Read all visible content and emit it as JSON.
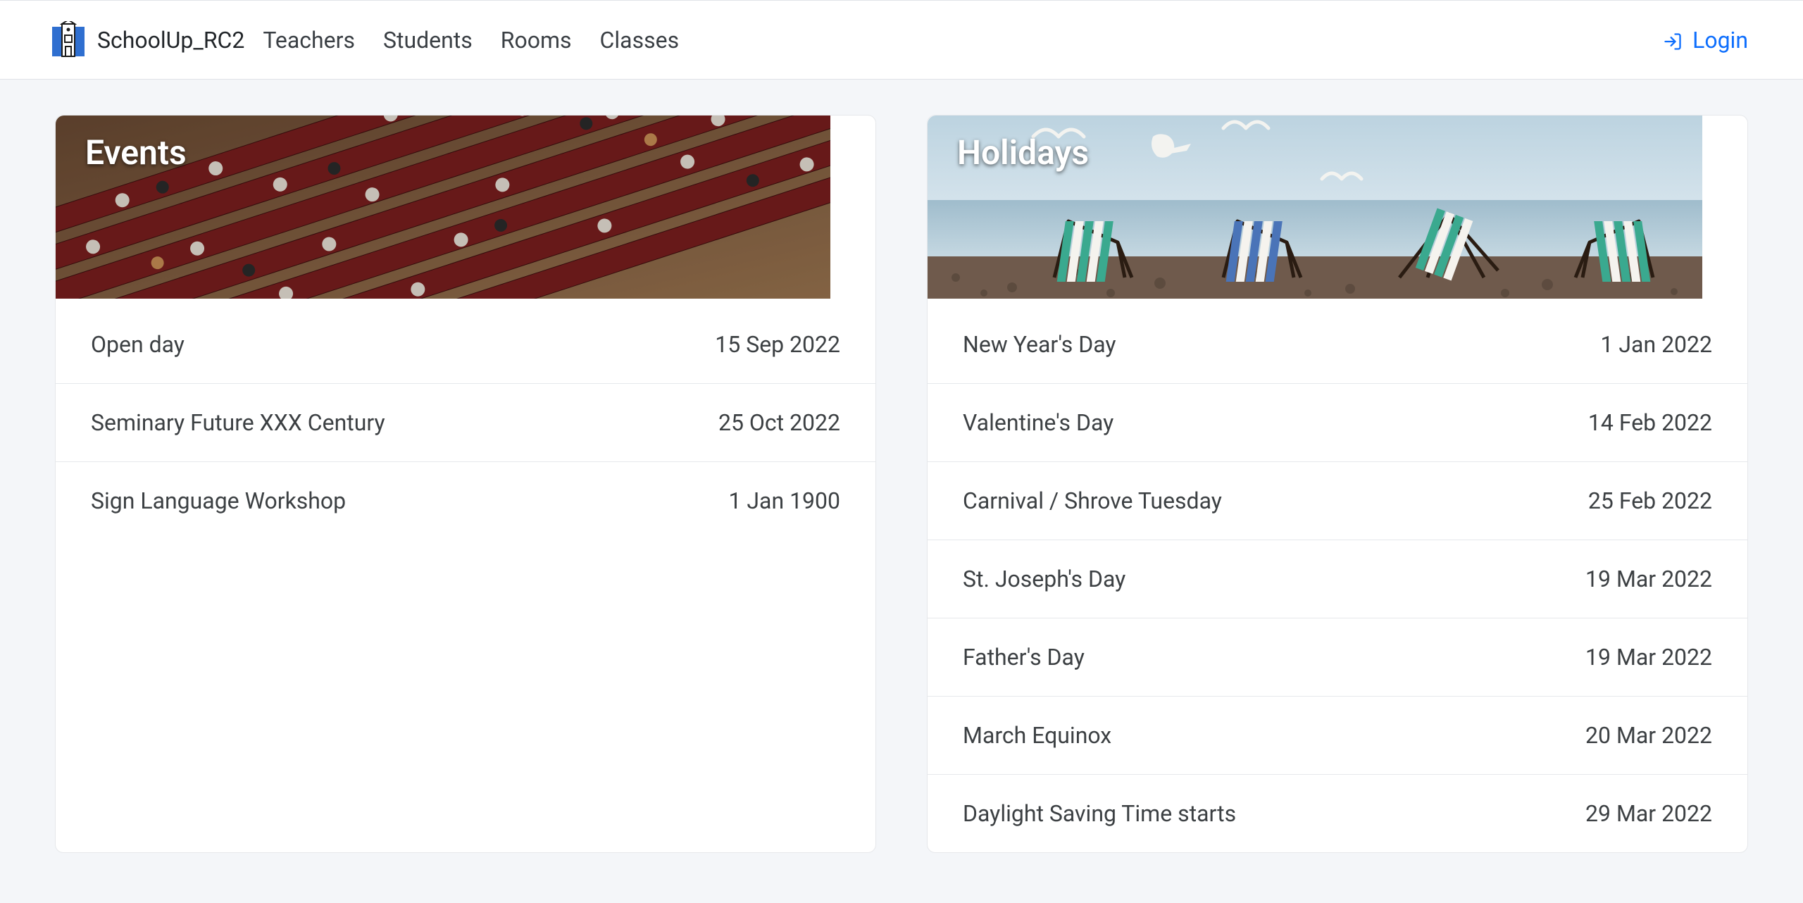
{
  "navbar": {
    "brand": "SchoolUp_RC2",
    "links": [
      {
        "label": "Teachers"
      },
      {
        "label": "Students"
      },
      {
        "label": "Rooms"
      },
      {
        "label": "Classes"
      }
    ],
    "login_label": "Login"
  },
  "cards": {
    "events": {
      "title": "Events",
      "items": [
        {
          "name": "Open day",
          "date": "15 Sep 2022"
        },
        {
          "name": "Seminary Future XXX Century",
          "date": "25 Oct 2022"
        },
        {
          "name": "Sign Language Workshop",
          "date": "1 Jan 1900"
        }
      ]
    },
    "holidays": {
      "title": "Holidays",
      "items": [
        {
          "name": "New Year's Day",
          "date": "1 Jan 2022"
        },
        {
          "name": "Valentine's Day",
          "date": "14 Feb 2022"
        },
        {
          "name": "Carnival / Shrove Tuesday",
          "date": "25 Feb 2022"
        },
        {
          "name": "St. Joseph's Day",
          "date": "19 Mar 2022"
        },
        {
          "name": "Father's Day",
          "date": "19 Mar 2022"
        },
        {
          "name": "March Equinox",
          "date": "20 Mar 2022"
        },
        {
          "name": "Daylight Saving Time starts",
          "date": "29 Mar 2022"
        }
      ]
    }
  }
}
